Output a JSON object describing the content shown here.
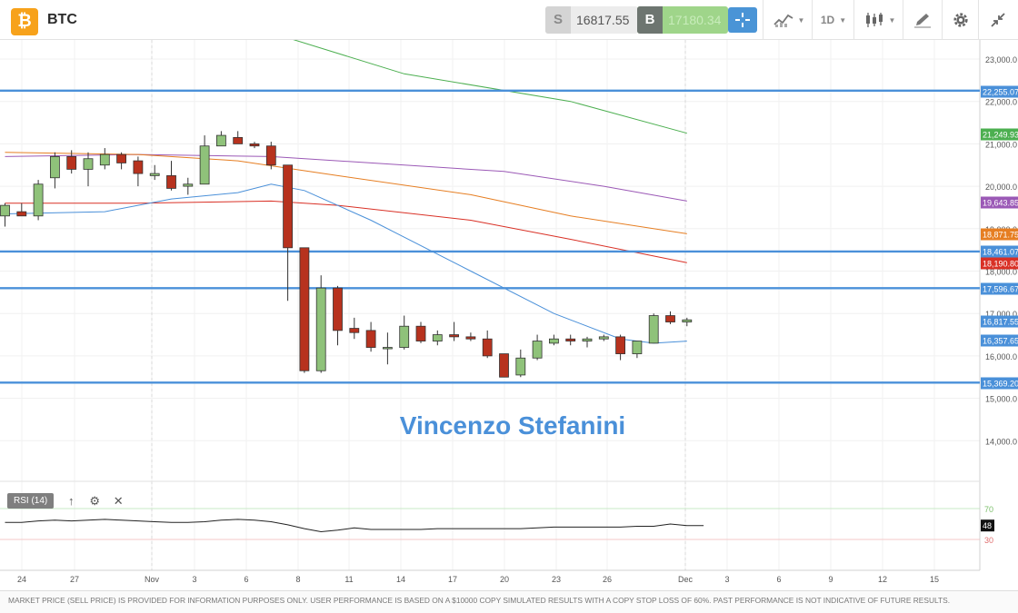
{
  "header": {
    "logo_glyph": "₿",
    "symbol": "BTC",
    "sell_label": "S",
    "sell_price": "16817.55",
    "buy_label": "B",
    "buy_price": "17180.34",
    "timeframe": "1D"
  },
  "watermark": "Vincenzo Stefanini",
  "price_axis": {
    "ticks": [
      "23,000.0",
      "22,000.0",
      "21,000.0",
      "20,000.0",
      "19,000.0",
      "18,000.0",
      "17,000.0",
      "16,000.0",
      "15,000.0",
      "14,000.0"
    ]
  },
  "price_labels": [
    {
      "text": "22,255.07",
      "color": "#4a90d9"
    },
    {
      "text": "21,249.93",
      "color": "#4caf50"
    },
    {
      "text": "19,643.85",
      "color": "#9b59b6"
    },
    {
      "text": "18,871.75",
      "color": "#e67e22"
    },
    {
      "text": "18,461.07",
      "color": "#4a90d9"
    },
    {
      "text": "18,190.80",
      "color": "#d93025"
    },
    {
      "text": "17,596.67",
      "color": "#4a90d9"
    },
    {
      "text": "16,817.55",
      "color": "#4a90d9"
    },
    {
      "text": "16,357.65",
      "color": "#4a90d9"
    },
    {
      "text": "15,369.20",
      "color": "#4a90d9"
    }
  ],
  "time_axis": {
    "labels": [
      "24",
      "27",
      "Nov",
      "3",
      "6",
      "8",
      "11",
      "14",
      "17",
      "20",
      "23",
      "26",
      "Dec",
      "3",
      "6",
      "9",
      "12",
      "15"
    ]
  },
  "rsi": {
    "label": "RSI (14)",
    "upper": "70",
    "lower": "30",
    "current": "48",
    "values": [
      52,
      52,
      54,
      55,
      54,
      55,
      56,
      55,
      54,
      53,
      52,
      52,
      53,
      55,
      56,
      55,
      53,
      49,
      44,
      40,
      42,
      45,
      43,
      43,
      43,
      43,
      44,
      44,
      44,
      44,
      44,
      44,
      45,
      46,
      46,
      46,
      46,
      46,
      47,
      47,
      50,
      48,
      48
    ]
  },
  "chart_data": {
    "type": "candlestick",
    "symbol": "BTC",
    "timeframe": "1D",
    "ylim": [
      13400,
      23600
    ],
    "candles": [
      {
        "o": 19300,
        "h": 19600,
        "l": 19050,
        "c": 19550
      },
      {
        "o": 19400,
        "h": 19600,
        "l": 19300,
        "c": 19300
      },
      {
        "o": 19300,
        "h": 20150,
        "l": 19200,
        "c": 20050
      },
      {
        "o": 20200,
        "h": 20800,
        "l": 19950,
        "c": 20700
      },
      {
        "o": 20700,
        "h": 20850,
        "l": 20300,
        "c": 20400
      },
      {
        "o": 20400,
        "h": 20800,
        "l": 20000,
        "c": 20650
      },
      {
        "o": 20500,
        "h": 20900,
        "l": 20400,
        "c": 20750
      },
      {
        "o": 20750,
        "h": 20800,
        "l": 20400,
        "c": 20550
      },
      {
        "o": 20600,
        "h": 20700,
        "l": 20000,
        "c": 20300
      },
      {
        "o": 20250,
        "h": 20500,
        "l": 20150,
        "c": 20300
      },
      {
        "o": 20250,
        "h": 20600,
        "l": 19900,
        "c": 19950
      },
      {
        "o": 20000,
        "h": 20200,
        "l": 19800,
        "c": 20050
      },
      {
        "o": 20050,
        "h": 21200,
        "l": 20050,
        "c": 20950
      },
      {
        "o": 20950,
        "h": 21300,
        "l": 20950,
        "c": 21200
      },
      {
        "o": 21150,
        "h": 21300,
        "l": 21000,
        "c": 21000
      },
      {
        "o": 21000,
        "h": 21050,
        "l": 20900,
        "c": 20950
      },
      {
        "o": 20950,
        "h": 21050,
        "l": 20400,
        "c": 20500
      },
      {
        "o": 20500,
        "h": 20500,
        "l": 17300,
        "c": 18550
      },
      {
        "o": 18550,
        "h": 18550,
        "l": 15600,
        "c": 15650
      },
      {
        "o": 15650,
        "h": 17900,
        "l": 15600,
        "c": 17600
      },
      {
        "o": 17600,
        "h": 17650,
        "l": 16250,
        "c": 16600
      },
      {
        "o": 16650,
        "h": 16900,
        "l": 16400,
        "c": 16550
      },
      {
        "o": 16600,
        "h": 16800,
        "l": 16100,
        "c": 16200
      },
      {
        "o": 16200,
        "h": 16550,
        "l": 15800,
        "c": 16200
      },
      {
        "o": 16200,
        "h": 16950,
        "l": 16150,
        "c": 16700
      },
      {
        "o": 16700,
        "h": 16800,
        "l": 16300,
        "c": 16350
      },
      {
        "o": 16350,
        "h": 16600,
        "l": 16250,
        "c": 16500
      },
      {
        "o": 16500,
        "h": 16800,
        "l": 16350,
        "c": 16450
      },
      {
        "o": 16450,
        "h": 16550,
        "l": 16350,
        "c": 16400
      },
      {
        "o": 16400,
        "h": 16600,
        "l": 15950,
        "c": 16000
      },
      {
        "o": 16050,
        "h": 16050,
        "l": 15500,
        "c": 15500
      },
      {
        "o": 15550,
        "h": 16150,
        "l": 15500,
        "c": 15950
      },
      {
        "o": 15950,
        "h": 16500,
        "l": 15900,
        "c": 16350
      },
      {
        "o": 16300,
        "h": 16500,
        "l": 16250,
        "c": 16400
      },
      {
        "o": 16400,
        "h": 16500,
        "l": 16250,
        "c": 16350
      },
      {
        "o": 16350,
        "h": 16450,
        "l": 16200,
        "c": 16400
      },
      {
        "o": 16400,
        "h": 16500,
        "l": 16350,
        "c": 16450
      },
      {
        "o": 16450,
        "h": 16500,
        "l": 15900,
        "c": 16050
      },
      {
        "o": 16050,
        "h": 16350,
        "l": 15950,
        "c": 16350
      },
      {
        "o": 16300,
        "h": 17000,
        "l": 16300,
        "c": 16950
      },
      {
        "o": 16950,
        "h": 17050,
        "l": 16750,
        "c": 16800
      },
      {
        "o": 16800,
        "h": 16900,
        "l": 16700,
        "c": 16850
      }
    ],
    "horizontal_levels": [
      22255.07,
      18461.07,
      17596.67,
      15369.2
    ],
    "moving_averages": [
      {
        "color": "#4caf50",
        "points": [
          [
            17,
            23500
          ],
          [
            24,
            22650
          ],
          [
            34,
            22000
          ],
          [
            41,
            21250
          ]
        ]
      },
      {
        "color": "#9b59b6",
        "points": [
          [
            0,
            20700
          ],
          [
            8,
            20750
          ],
          [
            16,
            20700
          ],
          [
            22,
            20550
          ],
          [
            30,
            20350
          ],
          [
            36,
            20000
          ],
          [
            41,
            19650
          ]
        ]
      },
      {
        "color": "#e67e22",
        "points": [
          [
            0,
            20800
          ],
          [
            8,
            20750
          ],
          [
            14,
            20600
          ],
          [
            20,
            20250
          ],
          [
            28,
            19800
          ],
          [
            34,
            19300
          ],
          [
            41,
            18880
          ]
        ]
      },
      {
        "color": "#d93025",
        "points": [
          [
            0,
            19600
          ],
          [
            8,
            19600
          ],
          [
            16,
            19650
          ],
          [
            20,
            19550
          ],
          [
            28,
            19200
          ],
          [
            34,
            18750
          ],
          [
            41,
            18200
          ]
        ]
      },
      {
        "color": "#4a90d9",
        "points": [
          [
            0,
            19350
          ],
          [
            6,
            19400
          ],
          [
            10,
            19700
          ],
          [
            14,
            19850
          ],
          [
            16,
            20050
          ],
          [
            18,
            19900
          ],
          [
            22,
            19200
          ],
          [
            28,
            18000
          ],
          [
            33,
            17000
          ],
          [
            37,
            16400
          ],
          [
            39,
            16300
          ],
          [
            41,
            16350
          ]
        ]
      }
    ]
  }
}
